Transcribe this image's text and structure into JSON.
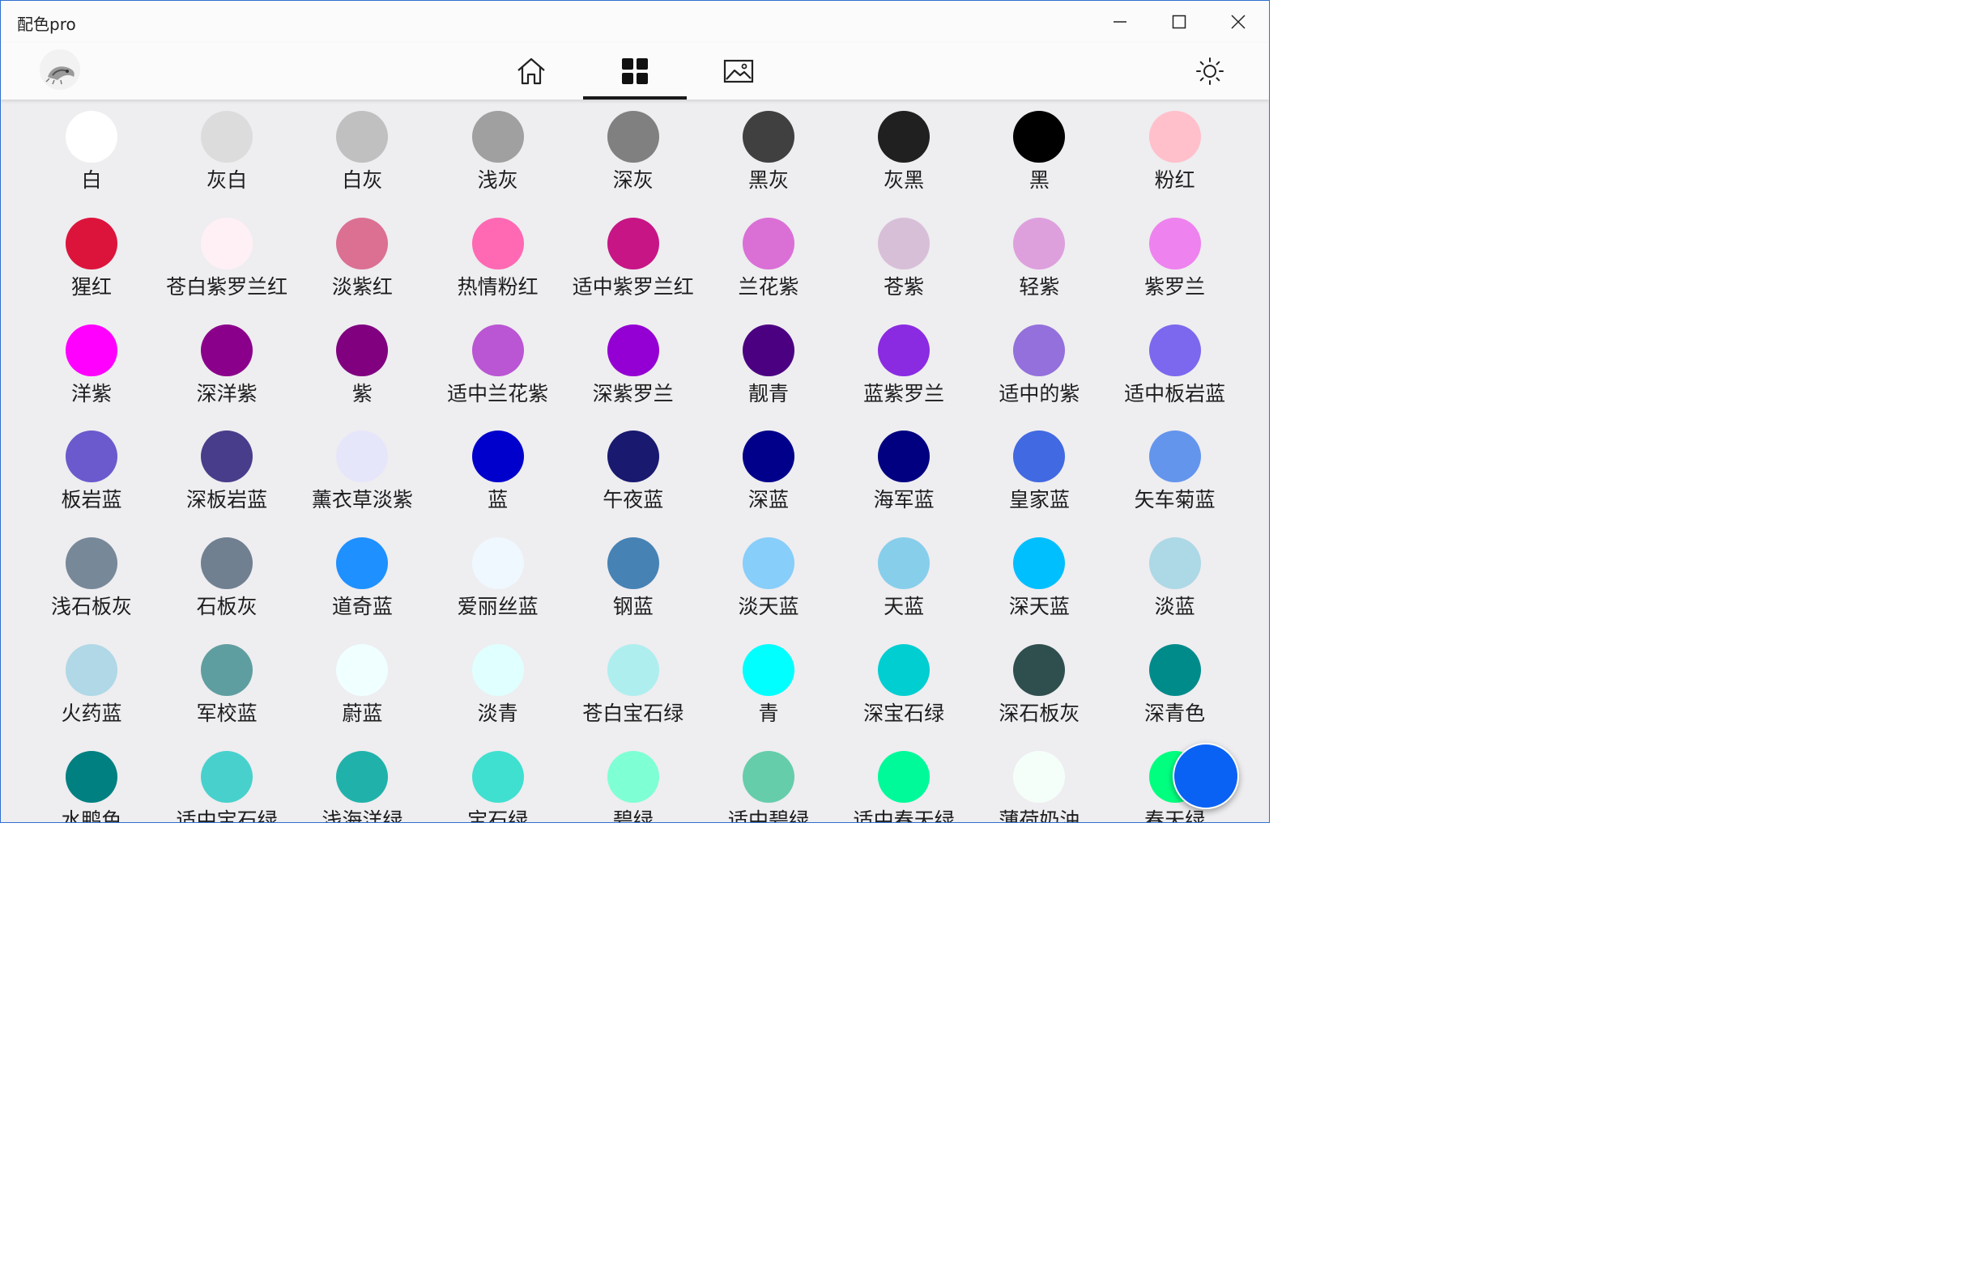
{
  "window": {
    "title": "配色pro"
  },
  "colors": [
    {
      "name": "白",
      "hex": "#FFFFFF"
    },
    {
      "name": "灰白",
      "hex": "#DCDCDC"
    },
    {
      "name": "白灰",
      "hex": "#C0C0C0"
    },
    {
      "name": "浅灰",
      "hex": "#A0A0A0"
    },
    {
      "name": "深灰",
      "hex": "#808080"
    },
    {
      "name": "黑灰",
      "hex": "#404040"
    },
    {
      "name": "灰黑",
      "hex": "#202020"
    },
    {
      "name": "黑",
      "hex": "#000000"
    },
    {
      "name": "粉红",
      "hex": "#FFC0CB"
    },
    {
      "name": "猩红",
      "hex": "#DC143C"
    },
    {
      "name": "苍白紫罗兰红",
      "hex": "#FFF0F5"
    },
    {
      "name": "淡紫红",
      "hex": "#DB7093"
    },
    {
      "name": "热情粉红",
      "hex": "#FF69B4"
    },
    {
      "name": "适中紫罗兰红",
      "hex": "#C71585"
    },
    {
      "name": "兰花紫",
      "hex": "#DA70D6"
    },
    {
      "name": "苍紫",
      "hex": "#D8BFD8"
    },
    {
      "name": "轻紫",
      "hex": "#DDA0DD"
    },
    {
      "name": "紫罗兰",
      "hex": "#EE82EE"
    },
    {
      "name": "洋紫",
      "hex": "#FF00FF"
    },
    {
      "name": "深洋紫",
      "hex": "#8B008B"
    },
    {
      "name": "紫",
      "hex": "#800080"
    },
    {
      "name": "适中兰花紫",
      "hex": "#BA55D3"
    },
    {
      "name": "深紫罗兰",
      "hex": "#9400D3"
    },
    {
      "name": "靓青",
      "hex": "#4B0082"
    },
    {
      "name": "蓝紫罗兰",
      "hex": "#8A2BE2"
    },
    {
      "name": "适中的紫",
      "hex": "#9370DB"
    },
    {
      "name": "适中板岩蓝",
      "hex": "#7B68EE"
    },
    {
      "name": "板岩蓝",
      "hex": "#6A5ACD"
    },
    {
      "name": "深板岩蓝",
      "hex": "#483D8B"
    },
    {
      "name": "薰衣草淡紫",
      "hex": "#E6E6FA"
    },
    {
      "name": "蓝",
      "hex": "#0000CD"
    },
    {
      "name": "午夜蓝",
      "hex": "#191970"
    },
    {
      "name": "深蓝",
      "hex": "#00008B"
    },
    {
      "name": "海军蓝",
      "hex": "#000080"
    },
    {
      "name": "皇家蓝",
      "hex": "#4169E1"
    },
    {
      "name": "矢车菊蓝",
      "hex": "#6495ED"
    },
    {
      "name": "浅石板灰",
      "hex": "#778899"
    },
    {
      "name": "石板灰",
      "hex": "#708090"
    },
    {
      "name": "道奇蓝",
      "hex": "#1E90FF"
    },
    {
      "name": "爱丽丝蓝",
      "hex": "#F0F8FF"
    },
    {
      "name": "钢蓝",
      "hex": "#4682B4"
    },
    {
      "name": "淡天蓝",
      "hex": "#87CEFA"
    },
    {
      "name": "天蓝",
      "hex": "#87CEEB"
    },
    {
      "name": "深天蓝",
      "hex": "#00BFFF"
    },
    {
      "name": "淡蓝",
      "hex": "#ADD8E6"
    },
    {
      "name": "火药蓝",
      "hex": "#B0D8E6"
    },
    {
      "name": "军校蓝",
      "hex": "#5F9EA0"
    },
    {
      "name": "蔚蓝",
      "hex": "#F0FFFF"
    },
    {
      "name": "淡青",
      "hex": "#E0FFFF"
    },
    {
      "name": "苍白宝石绿",
      "hex": "#AFEEEE"
    },
    {
      "name": "青",
      "hex": "#00FFFF"
    },
    {
      "name": "深宝石绿",
      "hex": "#00CED1"
    },
    {
      "name": "深石板灰",
      "hex": "#2F4F4F"
    },
    {
      "name": "深青色",
      "hex": "#008B8B"
    },
    {
      "name": "水鸭色",
      "hex": "#008080"
    },
    {
      "name": "适中宝石绿",
      "hex": "#48D1CC"
    },
    {
      "name": "浅海洋绿",
      "hex": "#20B2AA"
    },
    {
      "name": "宝石绿",
      "hex": "#40E0D0"
    },
    {
      "name": "碧绿",
      "hex": "#7FFFD4"
    },
    {
      "name": "适中碧绿",
      "hex": "#66CDAA"
    },
    {
      "name": "适中春天绿",
      "hex": "#00FA9A"
    },
    {
      "name": "薄荷奶油",
      "hex": "#F5FFFA"
    },
    {
      "name": "春天绿",
      "hex": "#00FF7F"
    }
  ],
  "fab": {
    "color": "#0A62F5"
  }
}
